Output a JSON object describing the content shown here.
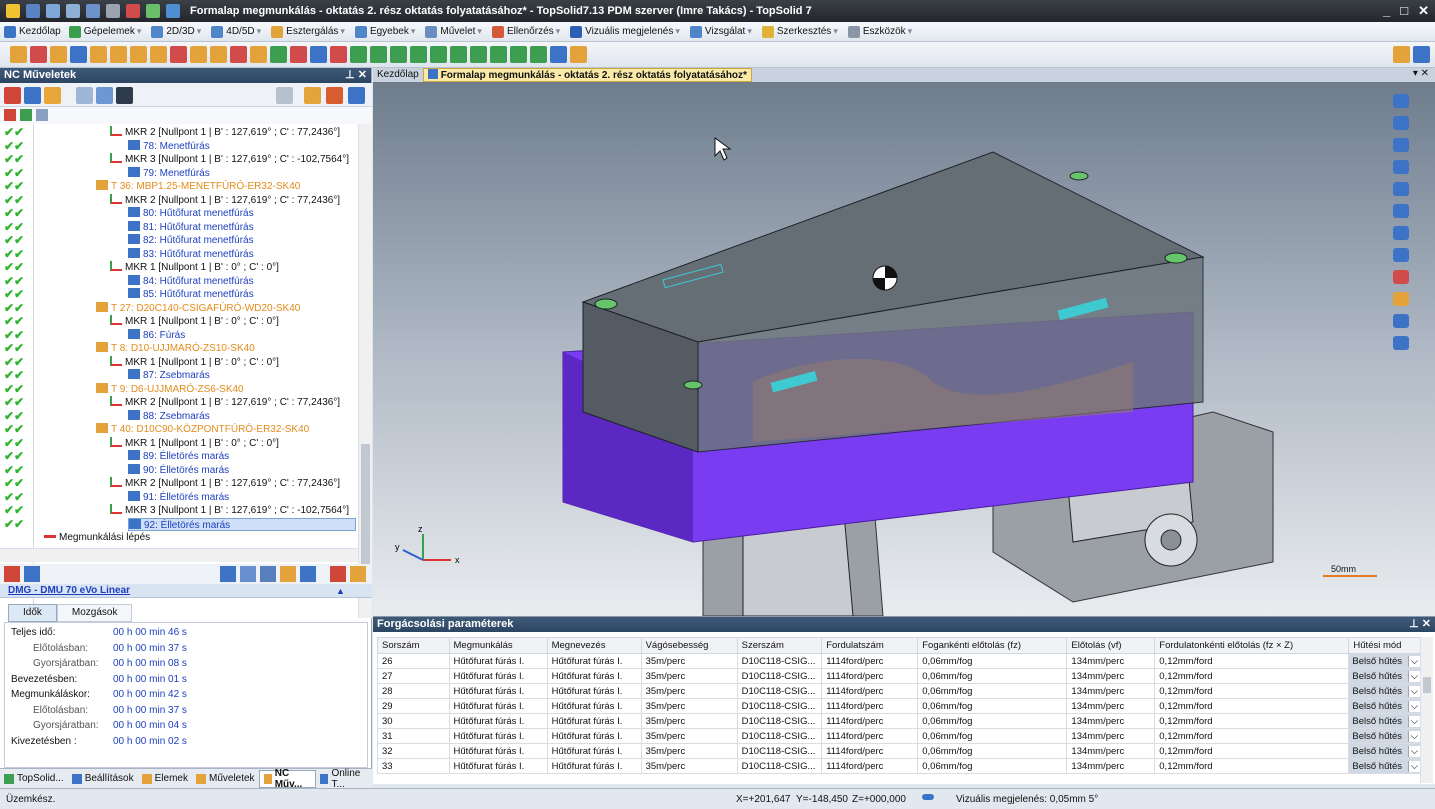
{
  "title": "Formalap megmunkálás - oktatás 2. rész oktatás folyatatásához* - TopSolid7.13 PDM szerver (Imre Takács) - TopSolid 7",
  "window_controls": [
    "_",
    "□",
    "✕"
  ],
  "menu": [
    "Kezdőlap",
    "Gépelemek",
    "2D/3D",
    "4D/5D",
    "Esztergálás",
    "Egyebek",
    "Művelet",
    "Ellenőrzés",
    "Vizuális megjelenés",
    "Vizsgálat",
    "Szerkesztés",
    "Eszközök"
  ],
  "left_panel": {
    "title": "NC Műveletek",
    "pin": "⊥ ✕",
    "tree": [
      {
        "text": "MKR 2 [Nullpont 1 | B' : 127,619° ; C' : 77,2436°]",
        "level": 3,
        "kind": "mkr",
        "check": true
      },
      {
        "text": "78: Menetfúrás",
        "level": 4,
        "kind": "op",
        "check": true
      },
      {
        "text": "MKR 3 [Nullpont 1 | B' : 127,619° ; C' : -102,7564°]",
        "level": 3,
        "kind": "mkr",
        "check": true
      },
      {
        "text": "79: Menetfúrás",
        "level": 4,
        "kind": "op",
        "check": true
      },
      {
        "text": "T 36: MBP1.25-MENETFÚRÓ-ER32-SK40",
        "level": 2,
        "kind": "tool",
        "check": true
      },
      {
        "text": "MKR 2 [Nullpont 1 | B' : 127,619° ; C' : 77,2436°]",
        "level": 3,
        "kind": "mkr",
        "check": true
      },
      {
        "text": "80: Hűtőfurat menetfúrás",
        "level": 4,
        "kind": "op",
        "check": true
      },
      {
        "text": "81: Hűtőfurat menetfúrás",
        "level": 4,
        "kind": "op",
        "check": true
      },
      {
        "text": "82: Hűtőfurat menetfúrás",
        "level": 4,
        "kind": "op",
        "check": true
      },
      {
        "text": "83: Hűtőfurat menetfúrás",
        "level": 4,
        "kind": "op",
        "check": true
      },
      {
        "text": "MKR 1 [Nullpont 1 | B' : 0° ; C' : 0°]",
        "level": 3,
        "kind": "mkr",
        "check": true
      },
      {
        "text": "84: Hűtőfurat menetfúrás",
        "level": 4,
        "kind": "op",
        "check": true
      },
      {
        "text": "85: Hűtőfurat menetfúrás",
        "level": 4,
        "kind": "op",
        "check": true
      },
      {
        "text": "T 27: D20C140-CSIGAFÚRÓ-WD20-SK40",
        "level": 2,
        "kind": "tool",
        "check": true
      },
      {
        "text": "MKR 1 [Nullpont 1 | B' : 0° ; C' : 0°]",
        "level": 3,
        "kind": "mkr",
        "check": true
      },
      {
        "text": "86: Fúrás",
        "level": 4,
        "kind": "op",
        "check": true
      },
      {
        "text": "T 8: D10-UJJMARÓ-ZS10-SK40",
        "level": 2,
        "kind": "tool",
        "check": true
      },
      {
        "text": "MKR 1 [Nullpont 1 | B' : 0° ; C' : 0°]",
        "level": 3,
        "kind": "mkr",
        "check": true
      },
      {
        "text": "87: Zsebmarás",
        "level": 4,
        "kind": "op",
        "check": true
      },
      {
        "text": "T 9: D6-UJJMARÓ-ZS6-SK40",
        "level": 2,
        "kind": "tool",
        "check": true
      },
      {
        "text": "MKR 2 [Nullpont 1 | B' : 127,619° ; C' : 77,2436°]",
        "level": 3,
        "kind": "mkr",
        "check": true
      },
      {
        "text": "88: Zsebmarás",
        "level": 4,
        "kind": "op",
        "check": true
      },
      {
        "text": "T 40: D10C90-KÖZPONTFÚRÓ-ER32-SK40",
        "level": 2,
        "kind": "tool",
        "check": true
      },
      {
        "text": "MKR 1 [Nullpont 1 | B' : 0° ; C' : 0°]",
        "level": 3,
        "kind": "mkr",
        "check": true
      },
      {
        "text": "89: Élletörés marás",
        "level": 4,
        "kind": "op",
        "check": true
      },
      {
        "text": "90: Élletörés marás",
        "level": 4,
        "kind": "op",
        "check": true
      },
      {
        "text": "MKR 2 [Nullpont 1 | B' : 127,619° ; C' : 77,2436°]",
        "level": 3,
        "kind": "mkr",
        "check": true
      },
      {
        "text": "91: Élletörés marás",
        "level": 4,
        "kind": "op",
        "check": true
      },
      {
        "text": "MKR 3 [Nullpont 1 | B' : 127,619° ; C' : -102,7564°]",
        "level": 3,
        "kind": "mkr",
        "check": true
      },
      {
        "text": "92: Élletörés marás",
        "level": 4,
        "kind": "op",
        "check": true,
        "selected": true
      },
      {
        "text": "Megmunkálási lépés",
        "level": 1,
        "kind": "step",
        "check": false
      }
    ],
    "machine": "DMG - DMU 70 eVo Linear",
    "tabs": [
      "Idők",
      "Mozgások"
    ],
    "times": [
      {
        "label": "Teljes idő:",
        "value": "00 h 00 min 46 s",
        "indent": false
      },
      {
        "label": "Előtolásban:",
        "value": "00 h 00 min 37 s",
        "indent": true
      },
      {
        "label": "Gyorsjáratban:",
        "value": "00 h 00 min 08 s",
        "indent": true
      },
      {
        "label": "Bevezetésben:",
        "value": "00 h 00 min 01 s",
        "indent": false
      },
      {
        "label": "Megmunkáláskor:",
        "value": "00 h 00 min 42 s",
        "indent": false
      },
      {
        "label": "Előtolásban:",
        "value": "00 h 00 min 37 s",
        "indent": true
      },
      {
        "label": "Gyorsjáratban:",
        "value": "00 h 00 min 04 s",
        "indent": true
      },
      {
        "label": "Kivezetésben :",
        "value": "00 h 00 min 02 s",
        "indent": false
      }
    ],
    "bottom_tabs": [
      "TopSolid...",
      "Beállítások",
      "Elemek",
      "Műveletek",
      "NC Műv...",
      "Online T..."
    ]
  },
  "doc_tabs": [
    "Kezdőlap",
    "Formalap megmunkálás - oktatás 2. rész oktatás folyatatásához*"
  ],
  "viewport": {
    "scale_label": "50mm"
  },
  "params": {
    "title": "Forgácsolási paraméterek",
    "columns": [
      "Sorszám",
      "Megmunkálás",
      "Megnevezés",
      "Vágósebesség",
      "Szerszám",
      "Fordulatszám",
      "Fogankénti előtolás (fz)",
      "Előtolás (vf)",
      "Fordulatonkénti előtolás (fz × Z)",
      "Hűtési mód"
    ],
    "rows": [
      [
        "26",
        "Hűtőfurat fúrás I.",
        "Hűtőfurat fúrás I.",
        "35m/perc",
        "D10C118-CSIG...",
        "1114ford/perc",
        "0,06mm/fog",
        "134mm/perc",
        "0,12mm/ford",
        "Belső hűtés"
      ],
      [
        "27",
        "Hűtőfurat fúrás I.",
        "Hűtőfurat fúrás I.",
        "35m/perc",
        "D10C118-CSIG...",
        "1114ford/perc",
        "0,06mm/fog",
        "134mm/perc",
        "0,12mm/ford",
        "Belső hűtés"
      ],
      [
        "28",
        "Hűtőfurat fúrás I.",
        "Hűtőfurat fúrás I.",
        "35m/perc",
        "D10C118-CSIG...",
        "1114ford/perc",
        "0,06mm/fog",
        "134mm/perc",
        "0,12mm/ford",
        "Belső hűtés"
      ],
      [
        "29",
        "Hűtőfurat fúrás I.",
        "Hűtőfurat fúrás I.",
        "35m/perc",
        "D10C118-CSIG...",
        "1114ford/perc",
        "0,06mm/fog",
        "134mm/perc",
        "0,12mm/ford",
        "Belső hűtés"
      ],
      [
        "30",
        "Hűtőfurat fúrás I.",
        "Hűtőfurat fúrás I.",
        "35m/perc",
        "D10C118-CSIG...",
        "1114ford/perc",
        "0,06mm/fog",
        "134mm/perc",
        "0,12mm/ford",
        "Belső hűtés"
      ],
      [
        "31",
        "Hűtőfurat fúrás I.",
        "Hűtőfurat fúrás I.",
        "35m/perc",
        "D10C118-CSIG...",
        "1114ford/perc",
        "0,06mm/fog",
        "134mm/perc",
        "0,12mm/ford",
        "Belső hűtés"
      ],
      [
        "32",
        "Hűtőfurat fúrás I.",
        "Hűtőfurat fúrás I.",
        "35m/perc",
        "D10C118-CSIG...",
        "1114ford/perc",
        "0,06mm/fog",
        "134mm/perc",
        "0,12mm/ford",
        "Belső hűtés"
      ],
      [
        "33",
        "Hűtőfurat fúrás I.",
        "Hűtőfurat fúrás I.",
        "35m/perc",
        "D10C118-CSIG...",
        "1114ford/perc",
        "0,06mm/fog",
        "134mm/perc",
        "0,12mm/ford",
        "Belső hűtés"
      ]
    ]
  },
  "status": {
    "left": "Üzemkész.",
    "x": "X=+201,647",
    "y": "Y=-148,450",
    "z": "Z=+000,000",
    "visual": "Vizuális megjelenés: 0,05mm 5°"
  },
  "colors": {
    "tool": "#e38b1a",
    "op": "#1d3fbf",
    "check": "#2fb52f",
    "part_purple": "#7a3cf0",
    "header": "#2c4562"
  }
}
